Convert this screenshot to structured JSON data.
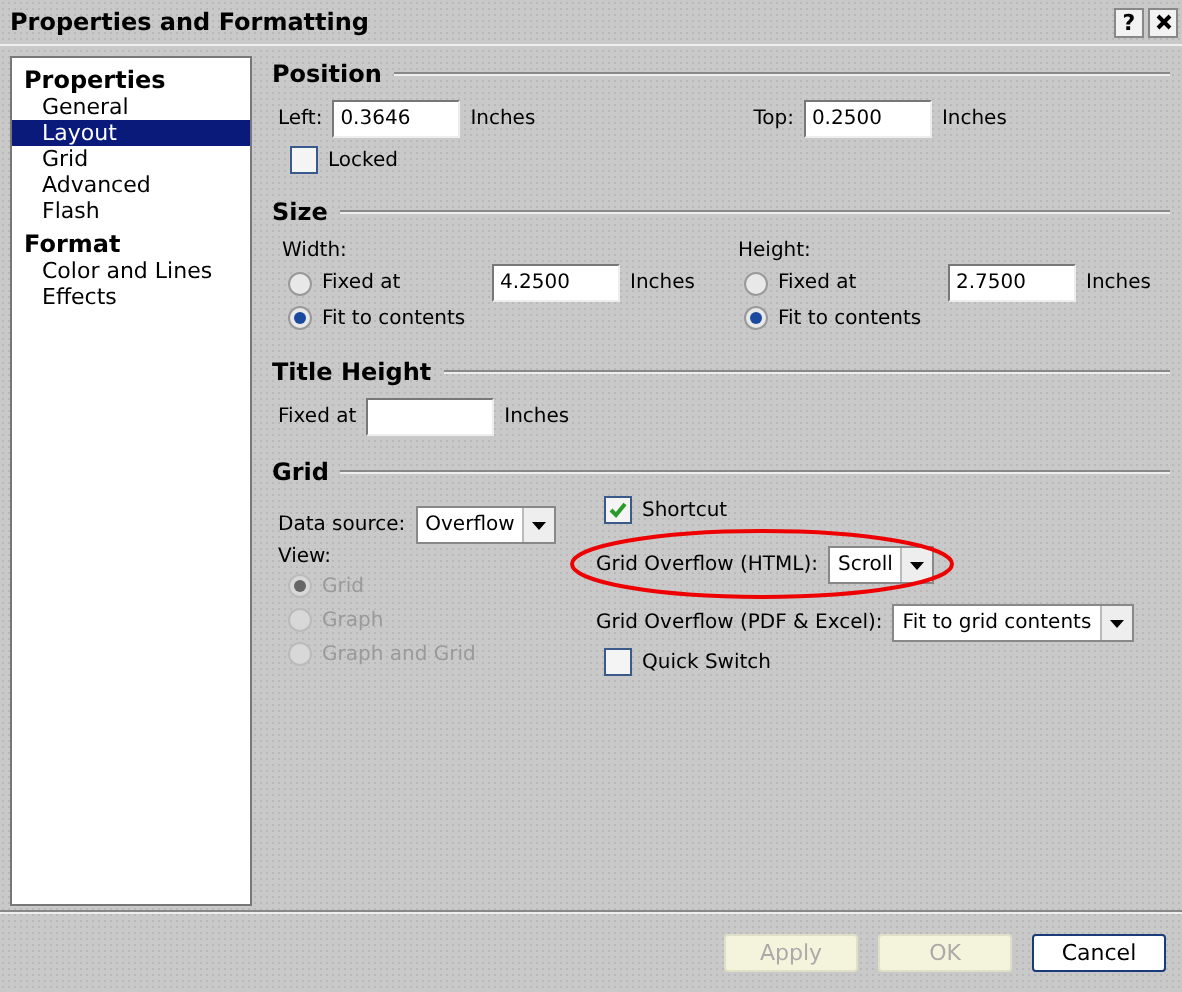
{
  "window": {
    "title": "Properties and Formatting",
    "help": "?"
  },
  "sidebar": {
    "groups": [
      {
        "label": "Properties",
        "items": [
          {
            "label": "General",
            "selected": false
          },
          {
            "label": "Layout",
            "selected": true
          },
          {
            "label": "Grid",
            "selected": false
          },
          {
            "label": "Advanced",
            "selected": false
          },
          {
            "label": "Flash",
            "selected": false
          }
        ]
      },
      {
        "label": "Format",
        "items": [
          {
            "label": "Color and Lines",
            "selected": false
          },
          {
            "label": "Effects",
            "selected": false
          }
        ]
      }
    ]
  },
  "position": {
    "heading": "Position",
    "left": {
      "label": "Left:",
      "value": "0.3646",
      "unit": "Inches"
    },
    "top": {
      "label": "Top:",
      "value": "0.2500",
      "unit": "Inches"
    },
    "locked": {
      "label": "Locked",
      "checked": false
    }
  },
  "size": {
    "heading": "Size",
    "columns": [
      {
        "label": "Width:",
        "options": [
          {
            "label": "Fixed at",
            "selected": false,
            "value": "4.2500",
            "unit": "Inches"
          },
          {
            "label": "Fit to contents",
            "selected": true
          }
        ]
      },
      {
        "label": "Height:",
        "options": [
          {
            "label": "Fixed at",
            "selected": false,
            "value": "2.7500",
            "unit": "Inches"
          },
          {
            "label": "Fit to contents",
            "selected": true
          }
        ]
      }
    ]
  },
  "title_height": {
    "heading": "Title Height",
    "label": "Fixed at",
    "unit": "Inches"
  },
  "grid": {
    "heading": "Grid",
    "data_source": {
      "label": "Data source:",
      "value": "Overflow"
    },
    "view": {
      "label": "View:",
      "options": [
        {
          "label": "Grid",
          "selected": true,
          "disabled": true
        },
        {
          "label": "Graph",
          "selected": false,
          "disabled": true
        },
        {
          "label": "Graph and Grid",
          "selected": false,
          "disabled": true
        }
      ]
    },
    "shortcut": {
      "label": "Shortcut",
      "checked": true
    },
    "overflow_html": {
      "label": "Grid Overflow (HTML):",
      "value": "Scroll",
      "highlighted": true
    },
    "overflow_pdf": {
      "label": "Grid Overflow (PDF & Excel):",
      "value": "Fit to grid contents"
    },
    "quick_switch": {
      "label": "Quick Switch",
      "checked": false
    }
  },
  "buttons": [
    {
      "label": "Apply",
      "disabled": true
    },
    {
      "label": "OK",
      "disabled": true
    },
    {
      "label": "Cancel",
      "disabled": false
    }
  ]
}
